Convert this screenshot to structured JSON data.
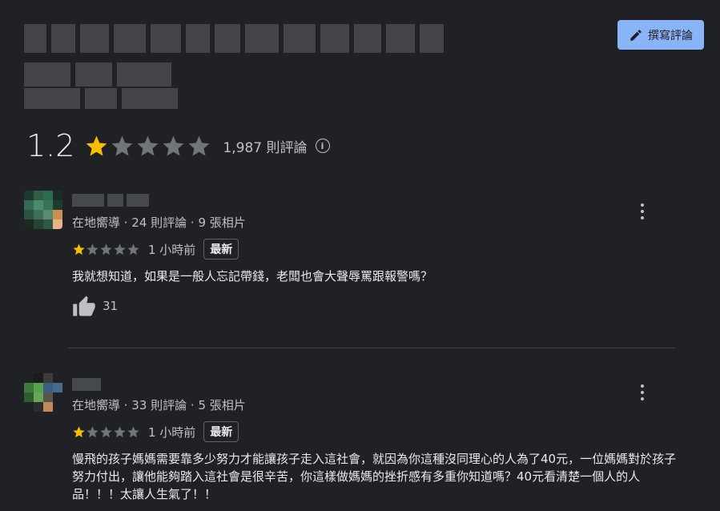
{
  "header": {
    "write_review_label": "撰寫評論"
  },
  "summary": {
    "score": "1.2",
    "rating": 1,
    "count_label": "1,987 則評論",
    "info_icon": "info-icon"
  },
  "colors": {
    "star_filled": "#fbbc04",
    "star_empty": "#70757a",
    "accent": "#8ab4f8"
  },
  "reviews": [
    {
      "meta": "在地嚮導 · 24 則評論 · 9 張相片",
      "rating": 1,
      "time": "1 小時前",
      "badge": "最新",
      "text": "我就想知道，如果是一般人忘記帶錢，老闆也會大聲辱罵跟報警嗎？",
      "likes": "31"
    },
    {
      "meta": "在地嚮導 · 33 則評論 · 5 張相片",
      "rating": 1,
      "time": "1 小時前",
      "badge": "最新",
      "text": "慢飛的孩子媽媽需要靠多少努力才能讓孩子走入這社會，就因為你這種沒同理心的人為了40元，一位媽媽對於孩子努力付出，讓他能夠踏入這社會是很辛苦，你這樣做媽媽的挫折感有多重你知道嗎？40元看清楚一個人的人品！！！太讓人生氣了！！"
    }
  ]
}
